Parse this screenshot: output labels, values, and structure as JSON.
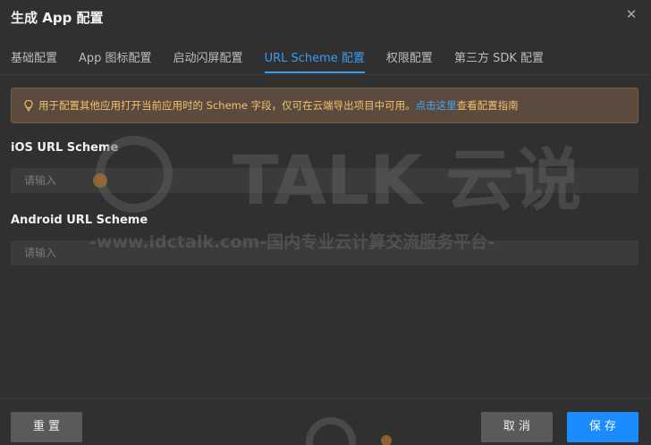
{
  "dialog": {
    "title": "生成 App 配置",
    "close_icon": "close-icon"
  },
  "tabs": [
    {
      "label": "基础配置",
      "active": false
    },
    {
      "label": "App 图标配置",
      "active": false
    },
    {
      "label": "启动闪屏配置",
      "active": false
    },
    {
      "label": "URL Scheme 配置",
      "active": true
    },
    {
      "label": "权限配置",
      "active": false
    },
    {
      "label": "第三方 SDK 配置",
      "active": false
    }
  ],
  "notice": {
    "icon": "bulb-icon",
    "text": "用于配置其他应用打开当前应用时的 Scheme 字段，仅可在云端导出项目中可用。",
    "link": "点击这里",
    "suffix": "查看配置指南"
  },
  "ios": {
    "label": "iOS URL Scheme",
    "value": "",
    "placeholder": "请输入"
  },
  "android": {
    "label": "Android URL Scheme",
    "value": "",
    "placeholder": "请输入"
  },
  "watermark": {
    "brand": "TALK 云说",
    "url": "-www.idctalk.com-国内专业云计算交流服务平台-"
  },
  "footer": {
    "reset_label": "重 置",
    "cancel_label": "取 消",
    "save_label": "保 存"
  },
  "colors": {
    "accent": "#3a9cf0",
    "primary_button": "#1a8cff",
    "notice_text": "#f2c16a",
    "notice_bg": "#5b4b3f"
  }
}
